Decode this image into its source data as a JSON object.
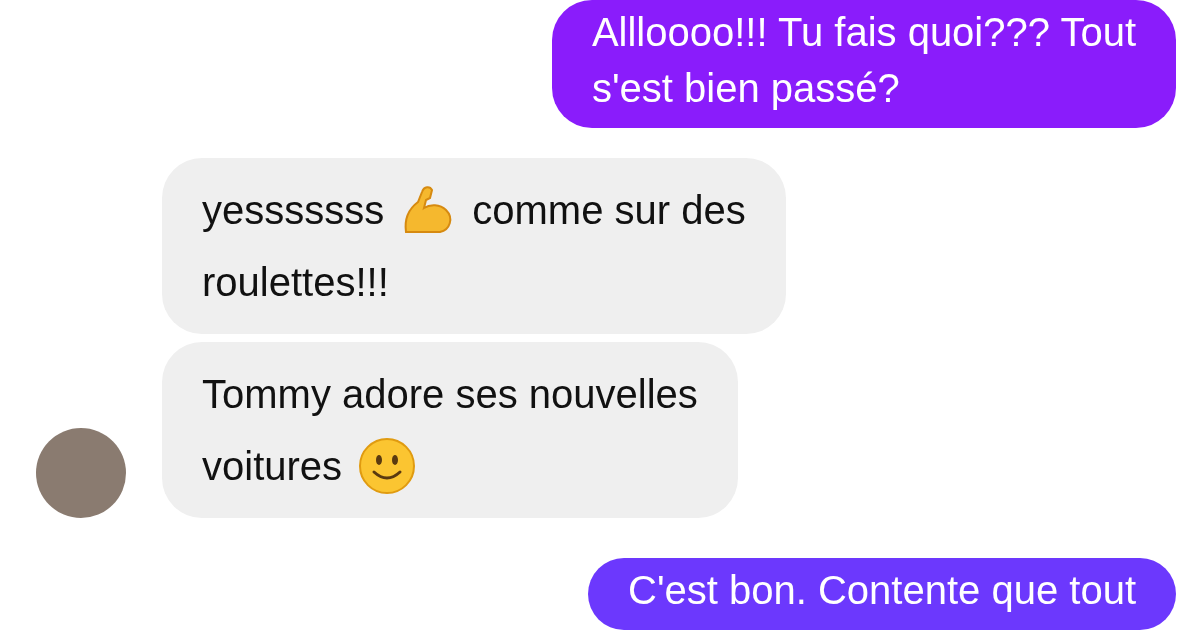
{
  "messages": [
    {
      "outgoing": true,
      "color": "#8a1cfb",
      "lines": [
        [
          {
            "kind": "text",
            "text": "Allloooo!!! Tu fais quoi??? Tout"
          }
        ],
        [
          {
            "kind": "text",
            "text": "s'est bien passé?"
          }
        ]
      ]
    },
    {
      "outgoing": false,
      "avatar": false,
      "lines": [
        [
          {
            "kind": "text",
            "text": "yesssssss"
          },
          {
            "kind": "flexed-arm"
          },
          {
            "kind": "text",
            "text": "comme sur des"
          }
        ],
        [
          {
            "kind": "text",
            "text": "roulettes!!!"
          }
        ]
      ]
    },
    {
      "outgoing": false,
      "avatar": true,
      "lines": [
        [
          {
            "kind": "text",
            "text": "Tommy adore ses nouvelles"
          }
        ],
        [
          {
            "kind": "text",
            "text": "voitures"
          },
          {
            "kind": "smile"
          }
        ]
      ]
    },
    {
      "outgoing": true,
      "color": "#6c38fd",
      "lines": [
        [
          {
            "kind": "text",
            "text": "C'est bon. Contente que tout"
          }
        ]
      ]
    }
  ]
}
